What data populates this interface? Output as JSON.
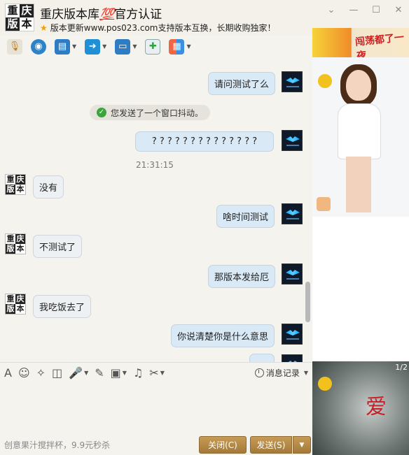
{
  "window": {
    "title": "重庆版本库",
    "title_badge": "💯",
    "title_suffix": "官方认证",
    "subtitle": "版本更新www.pos023.com支持版本互换，长期收购独家！",
    "logo_chars": [
      "重",
      "庆",
      "版",
      "本"
    ]
  },
  "toolbar": {
    "items": [
      "mic-icon",
      "video-call-icon",
      "screen-share-icon",
      "file-transfer-icon",
      "remote-desktop-icon",
      "add-app-icon",
      "apps-grid-icon"
    ]
  },
  "chat": {
    "system_note": "您发送了一个窗口抖动。",
    "timestamp": "21:31:15",
    "messages": [
      {
        "side": "out",
        "text": "请问测试了么"
      },
      {
        "side": "out",
        "text": "? ? ? ? ? ? ? ? ? ? ? ? ? ?"
      },
      {
        "side": "in",
        "text": "没有"
      },
      {
        "side": "out",
        "text": "啥时间测试"
      },
      {
        "side": "in",
        "text": "不测试了"
      },
      {
        "side": "out",
        "text": "那版本发给厄"
      },
      {
        "side": "in",
        "text": "我吃饭去了"
      },
      {
        "side": "out",
        "text": "你说清楚你是什么意思"
      }
    ]
  },
  "input_toolbar": {
    "history_label": "消息记录"
  },
  "footer": {
    "status_text": "创意果汁搅拌杯，9.9元秒杀",
    "close_label": "关闭(C)",
    "send_label": "发送(S)"
  },
  "right_panel": {
    "ad_text": "闯荡都了一夜",
    "video_text": "爱",
    "page_indicator": "1/2"
  }
}
